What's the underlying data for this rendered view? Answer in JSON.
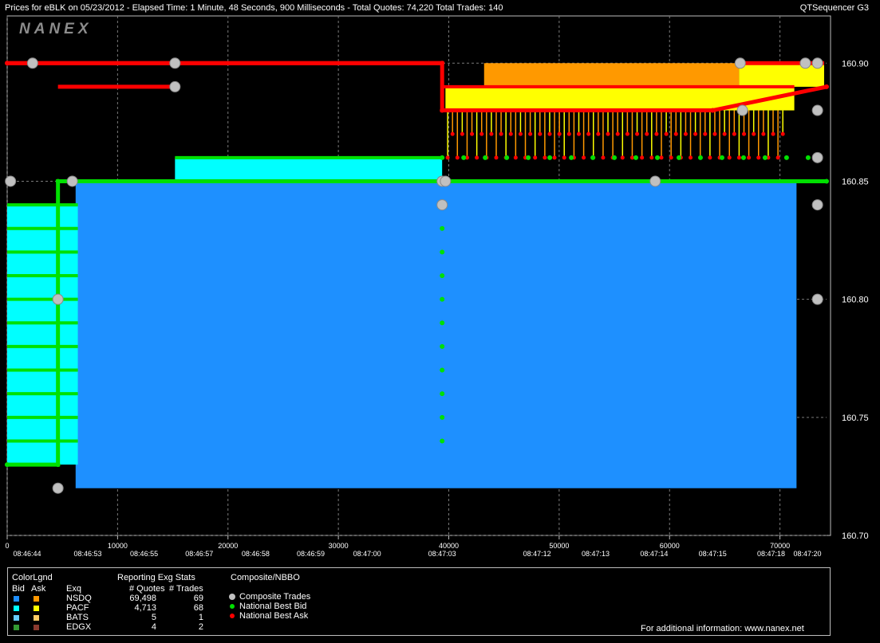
{
  "header": {
    "title": "Prices for  eBLK  on  05/23/2012  -  Elapsed Time: 1 Minute, 48 Seconds, 900 Milliseconds  -  Total Quotes: 74,220  Total Trades: 140",
    "app_name": "QTSequencer G3"
  },
  "watermark": "NANEX",
  "chart_data": {
    "type": "line",
    "xlim": [
      0,
      74220
    ],
    "ylim": [
      160.7,
      160.92
    ],
    "x_ticks": [
      "0",
      "10000",
      "20000",
      "30000",
      "40000",
      "50000",
      "60000",
      "70000"
    ],
    "x_tick_values": [
      0,
      10000,
      20000,
      30000,
      40000,
      50000,
      60000,
      70000
    ],
    "time_labels": [
      "08:46:44",
      "08:46:53",
      "08:46:55",
      "08:46:57",
      "08:46:58",
      "08:46:59",
      "08:47:00",
      "08:47:03",
      "08:47:12",
      "08:47:13",
      "08:47:14",
      "08:47:15",
      "08:47:18",
      "08:47:20"
    ],
    "time_label_x": [
      0,
      7300,
      12400,
      17400,
      22500,
      27500,
      32600,
      39400,
      48000,
      53300,
      58600,
      63900,
      69200,
      74000
    ],
    "y_ticks": [
      "160.90",
      "160.85",
      "160.80",
      "160.75",
      "160.70"
    ],
    "y_tick_values": [
      160.9,
      160.85,
      160.8,
      160.75,
      160.7
    ],
    "series": [
      {
        "name": "National Best Bid",
        "x": [
          0,
          4600,
          4600,
          39400,
          74220
        ],
        "y": [
          160.73,
          160.73,
          160.85,
          160.85,
          160.85
        ]
      },
      {
        "name": "National Best Ask",
        "x": [
          0,
          39400,
          39400,
          63900,
          74220
        ],
        "y": [
          160.9,
          160.9,
          160.88,
          160.88,
          160.89
        ]
      },
      {
        "name": "Composite Trades",
        "x": [
          300,
          2300,
          4600,
          4600,
          5900,
          15200,
          15200,
          39400,
          39400,
          39700,
          58700,
          66400,
          66600,
          72300,
          73400,
          73400,
          73400,
          73400,
          73400
        ],
        "y": [
          160.85,
          160.9,
          160.72,
          160.8,
          160.85,
          160.9,
          160.89,
          160.84,
          160.85,
          160.85,
          160.85,
          160.9,
          160.88,
          160.9,
          160.9,
          160.88,
          160.86,
          160.84,
          160.8
        ]
      }
    ]
  },
  "legend": {
    "colorlgnd": "ColorLgnd",
    "bid": "Bid",
    "ask": "Ask",
    "exq_header": "Exq",
    "stats_title": "Reporting Exg Stats",
    "quotes_header": "# Quotes",
    "trades_header": "# Trades",
    "composite_title": "Composite/NBBO",
    "rows": [
      {
        "exq": "NSDQ",
        "quotes": "69,498",
        "trades": "69",
        "bid_color": "#1e90ff",
        "ask_color": "#ff9900"
      },
      {
        "exq": "PACF",
        "quotes": "4,713",
        "trades": "68",
        "bid_color": "#00ffff",
        "ask_color": "#ffff00"
      },
      {
        "exq": "BATS",
        "quotes": "5",
        "trades": "1",
        "bid_color": "#66ccff",
        "ask_color": "#ffcc66"
      },
      {
        "exq": "EDGX",
        "quotes": "4",
        "trades": "2",
        "bid_color": "#339933",
        "ask_color": "#8b3a2f"
      }
    ],
    "marker_items": [
      {
        "label": "Composite Trades",
        "color": "#c0c0c0"
      },
      {
        "label": "National Best Bid",
        "color": "#00e000"
      },
      {
        "label": "National Best Ask",
        "color": "#ff0000"
      }
    ],
    "footer": "For additional information: www.nanex.net"
  }
}
